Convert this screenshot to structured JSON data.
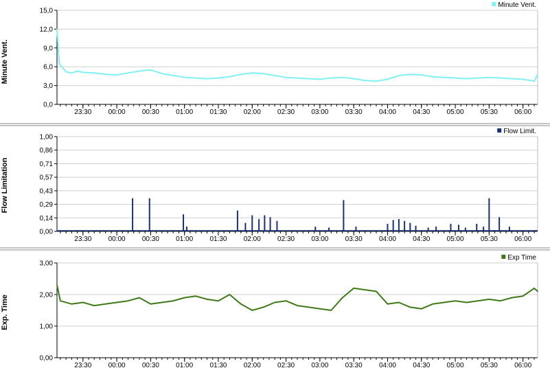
{
  "chart_data": [
    {
      "type": "line",
      "ylabel": "Minute Vent.",
      "legend": "Minute Vent.",
      "legend_position": "top-right",
      "color": "#7ef2f2",
      "ylim": [
        0,
        15
      ],
      "yticks": [
        "0,0",
        "3,0",
        "6,0",
        "9,0",
        "12,0",
        "15,0"
      ],
      "grid": true,
      "xlim": [
        "23:07",
        "06:13"
      ],
      "xticks": [
        "23:30",
        "00:00",
        "00:30",
        "01:00",
        "01:30",
        "02:00",
        "02:30",
        "03:00",
        "03:30",
        "04:00",
        "04:30",
        "05:00",
        "05:30",
        "06:00"
      ],
      "x": [
        "23:07",
        "23:09",
        "23:15",
        "23:20",
        "23:25",
        "23:30",
        "23:40",
        "23:50",
        "00:00",
        "00:10",
        "00:20",
        "00:30",
        "00:40",
        "00:50",
        "01:00",
        "01:10",
        "01:20",
        "01:30",
        "01:40",
        "01:50",
        "02:00",
        "02:10",
        "02:20",
        "02:30",
        "02:40",
        "02:50",
        "03:00",
        "03:10",
        "03:20",
        "03:30",
        "03:40",
        "03:50",
        "04:00",
        "04:10",
        "04:20",
        "04:30",
        "04:40",
        "04:50",
        "05:00",
        "05:10",
        "05:20",
        "05:30",
        "05:40",
        "05:50",
        "06:00",
        "06:10",
        "06:13"
      ],
      "values": [
        12.0,
        6.5,
        5.2,
        5.0,
        5.3,
        5.1,
        5.0,
        4.8,
        4.7,
        5.0,
        5.3,
        5.5,
        4.9,
        4.6,
        4.3,
        4.2,
        4.1,
        4.2,
        4.4,
        4.8,
        5.0,
        4.9,
        4.6,
        4.3,
        4.2,
        4.1,
        4.0,
        4.2,
        4.3,
        4.1,
        3.8,
        3.7,
        4.0,
        4.6,
        4.8,
        4.7,
        4.4,
        4.3,
        4.2,
        4.1,
        4.2,
        4.3,
        4.2,
        4.1,
        4.0,
        3.7,
        4.8
      ]
    },
    {
      "type": "bar",
      "ylabel": "Flow Limitation",
      "legend": "Flow Limit.",
      "legend_position": "top-right",
      "color": "#1a2f7a",
      "ylim": [
        0,
        1.0
      ],
      "yticks": [
        "0,00",
        "0,14",
        "0,29",
        "0,43",
        "0,57",
        "0,71",
        "0,86",
        "1,00"
      ],
      "grid": true,
      "xlim": [
        "23:07",
        "06:13"
      ],
      "xticks": [
        "23:30",
        "00:00",
        "00:30",
        "01:00",
        "01:30",
        "02:00",
        "02:30",
        "03:00",
        "03:30",
        "04:00",
        "04:30",
        "05:00",
        "05:30",
        "06:00"
      ],
      "x": [
        "00:14",
        "00:29",
        "00:59",
        "01:02",
        "01:47",
        "01:54",
        "02:00",
        "02:06",
        "02:11",
        "02:16",
        "02:22",
        "02:56",
        "03:08",
        "03:21",
        "03:32",
        "04:00",
        "04:05",
        "04:10",
        "04:15",
        "04:20",
        "04:25",
        "04:36",
        "04:43",
        "04:56",
        "05:03",
        "05:09",
        "05:19",
        "05:25",
        "05:30",
        "05:39",
        "05:48"
      ],
      "values": [
        0.35,
        0.35,
        0.18,
        0.05,
        0.22,
        0.09,
        0.17,
        0.13,
        0.17,
        0.15,
        0.11,
        0.05,
        0.04,
        0.33,
        0.05,
        0.08,
        0.12,
        0.13,
        0.11,
        0.09,
        0.06,
        0.04,
        0.05,
        0.08,
        0.07,
        0.04,
        0.08,
        0.05,
        0.35,
        0.15,
        0.05
      ]
    },
    {
      "type": "line",
      "ylabel": "Exp. Time",
      "legend": "Exp Time",
      "legend_position": "top-right",
      "color": "#3d7a16",
      "ylim": [
        0,
        3.0
      ],
      "yticks": [
        "0,00",
        "1,00",
        "2,00",
        "3,00"
      ],
      "grid": true,
      "xlim": [
        "23:07",
        "06:13"
      ],
      "xticks": [
        "23:30",
        "00:00",
        "00:30",
        "01:00",
        "01:30",
        "02:00",
        "02:30",
        "03:00",
        "03:30",
        "04:00",
        "04:30",
        "05:00",
        "05:30",
        "06:00"
      ],
      "x": [
        "23:07",
        "23:10",
        "23:20",
        "23:30",
        "23:40",
        "23:50",
        "00:00",
        "00:10",
        "00:20",
        "00:30",
        "00:40",
        "00:50",
        "01:00",
        "01:10",
        "01:20",
        "01:30",
        "01:40",
        "01:50",
        "02:00",
        "02:10",
        "02:20",
        "02:30",
        "02:40",
        "02:50",
        "03:00",
        "03:10",
        "03:20",
        "03:30",
        "03:40",
        "03:50",
        "04:00",
        "04:10",
        "04:20",
        "04:30",
        "04:40",
        "04:50",
        "05:00",
        "05:10",
        "05:20",
        "05:30",
        "05:40",
        "05:50",
        "06:00",
        "06:10",
        "06:13"
      ],
      "values": [
        2.3,
        1.8,
        1.7,
        1.75,
        1.65,
        1.7,
        1.75,
        1.8,
        1.9,
        1.7,
        1.75,
        1.8,
        1.9,
        1.95,
        1.85,
        1.8,
        2.0,
        1.7,
        1.5,
        1.6,
        1.75,
        1.8,
        1.65,
        1.6,
        1.55,
        1.5,
        1.9,
        2.2,
        2.15,
        2.1,
        1.7,
        1.75,
        1.6,
        1.55,
        1.7,
        1.75,
        1.8,
        1.75,
        1.8,
        1.85,
        1.8,
        1.9,
        1.95,
        2.2,
        2.1
      ]
    }
  ]
}
